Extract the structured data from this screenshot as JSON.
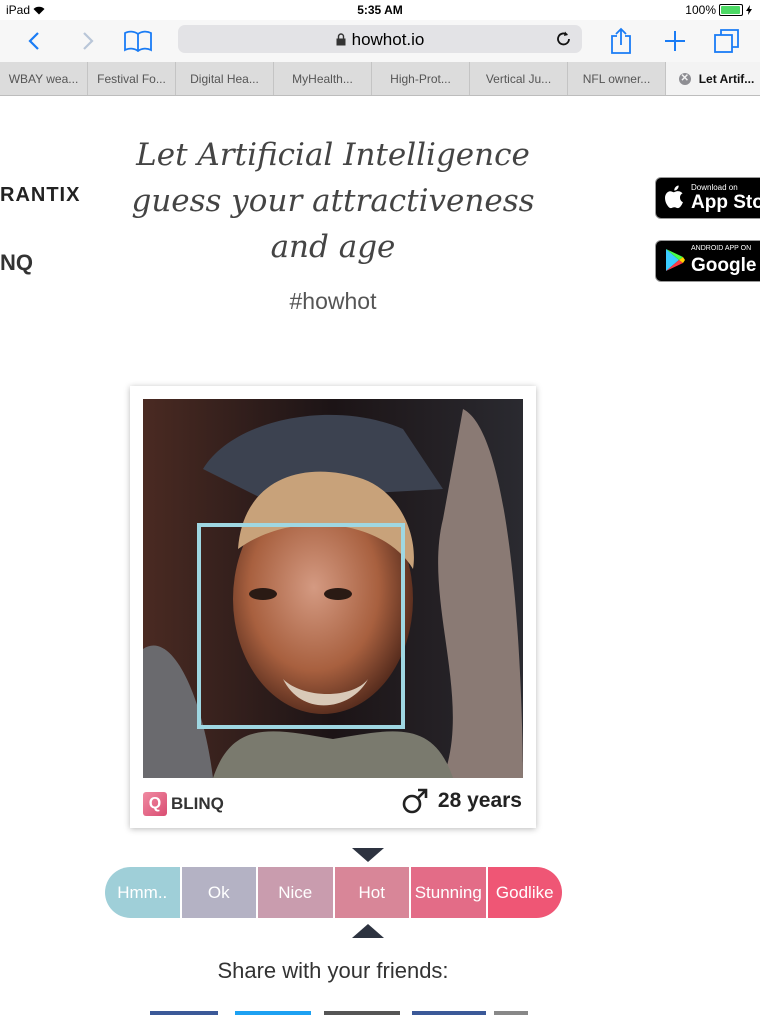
{
  "status_bar": {
    "device": "iPad",
    "time": "5:35 AM",
    "battery": "100%"
  },
  "toolbar": {
    "url": "howhot.io"
  },
  "tabs": [
    {
      "label": "WBAY wea..."
    },
    {
      "label": "Festival Fo..."
    },
    {
      "label": "Digital Hea..."
    },
    {
      "label": "MyHealth..."
    },
    {
      "label": "High-Prot..."
    },
    {
      "label": "Vertical Ju..."
    },
    {
      "label": "NFL owner..."
    },
    {
      "label": "Let Artif..."
    }
  ],
  "page": {
    "logo_left_1": "RANTIX",
    "logo_left_2": "NQ",
    "headline_line1": "Let Artificial Intelligence",
    "headline_line2": "guess your attractiveness",
    "headline_line3": "and age",
    "hashtag": "#howhot",
    "app_store": {
      "small": "Download on",
      "large": "App Sto"
    },
    "google_play": {
      "small": "ANDROID APP ON",
      "large": "Google Pl"
    },
    "card": {
      "brand": "BLINQ",
      "brand_icon": "Q",
      "age": "28 years"
    },
    "scale": [
      {
        "label": "Hmm..",
        "color": "#9fcfd8"
      },
      {
        "label": "Ok",
        "color": "#b4b2c4"
      },
      {
        "label": "Nice",
        "color": "#c99cae"
      },
      {
        "label": "Hot",
        "color": "#d88698"
      },
      {
        "label": "Stunning",
        "color": "#e36c87"
      },
      {
        "label": "Godlike",
        "color": "#ef5675"
      }
    ],
    "selected_rating": "Hot",
    "share_text": "Share with your friends:"
  }
}
